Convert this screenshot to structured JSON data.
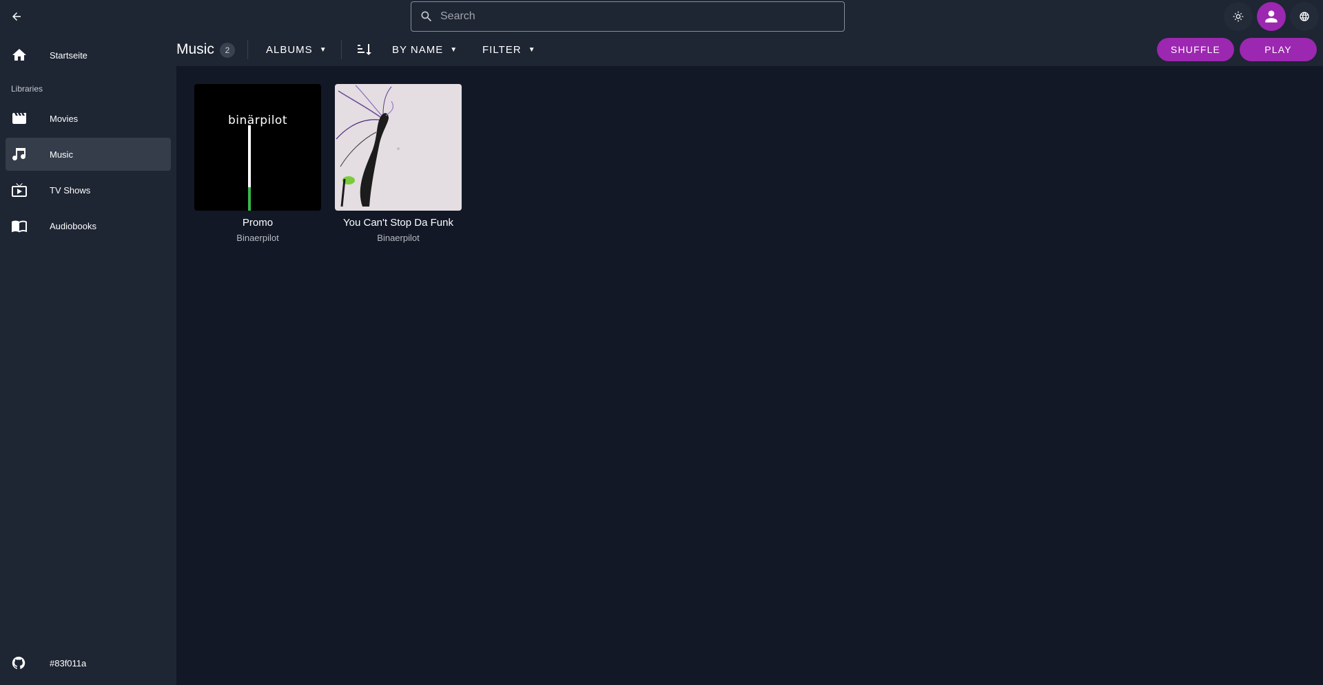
{
  "search": {
    "placeholder": "Search",
    "value": ""
  },
  "sidebar": {
    "home_label": "Startseite",
    "libraries_heading": "Libraries",
    "items": [
      {
        "label": "Movies",
        "icon": "movie-icon"
      },
      {
        "label": "Music",
        "icon": "music-note-icon",
        "active": true
      },
      {
        "label": "TV Shows",
        "icon": "tv-icon"
      },
      {
        "label": "Audiobooks",
        "icon": "book-icon"
      }
    ],
    "footer_label": "#83f011a",
    "footer_icon": "github-icon"
  },
  "toolbar": {
    "title": "Music",
    "count": "2",
    "view_mode": "ALBUMS",
    "sort_by": "BY NAME",
    "filter": "FILTER",
    "shuffle_label": "SHUFFLE",
    "play_label": "PLAY"
  },
  "albums": [
    {
      "title": "Promo",
      "artist": "Binaerpilot",
      "cover_text": "binärpilot"
    },
    {
      "title": "You Can't Stop Da Funk",
      "artist": "Binaerpilot"
    }
  ],
  "colors": {
    "accent": "#9c27b0",
    "background": "#121826",
    "surface": "#1e2533",
    "active_item": "#353c4a"
  }
}
